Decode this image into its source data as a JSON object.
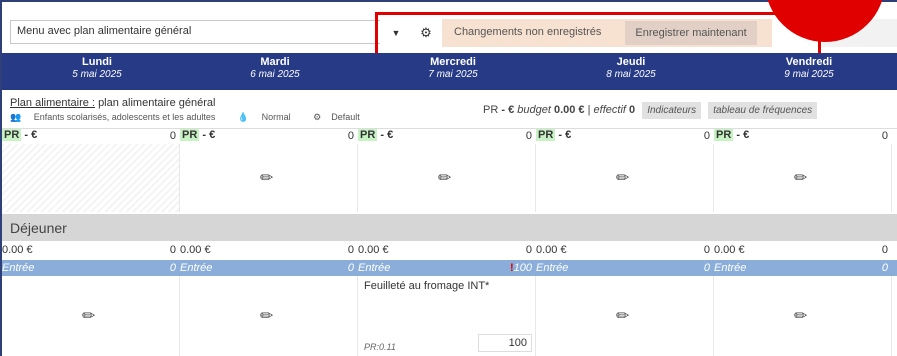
{
  "toolbar": {
    "menu_name": "Menu avec plan alimentaire général",
    "unsaved_text": "Changements non enregistrés",
    "save_label": "Enregistrer maintenant"
  },
  "days": [
    {
      "name": "Lundi",
      "date": "5 mai 2025"
    },
    {
      "name": "Mardi",
      "date": "6 mai 2025"
    },
    {
      "name": "Mercredi",
      "date": "7 mai 2025"
    },
    {
      "name": "Jeudi",
      "date": "8 mai 2025"
    },
    {
      "name": "Vendredi",
      "date": "9 mai 2025"
    }
  ],
  "plan": {
    "label": "Plan alimentaire :",
    "value": "plan alimentaire général",
    "audience": "Enfants scolarisés, adolescents et les adultes",
    "mode": "Normal",
    "profile": "Default",
    "pr_prefix": "PR",
    "pr_value": "- €",
    "budget_label": "budget",
    "budget_value": "0.00 €",
    "effectif_label": "effectif",
    "effectif_value": "0",
    "indicateurs_label": "Indicateurs",
    "frequences_label": "tableau de fréquences"
  },
  "pr_cells": [
    {
      "tag": "PR",
      "value": "- €",
      "count": "0"
    },
    {
      "tag": "PR",
      "value": "- €",
      "count": "0"
    },
    {
      "tag": "PR",
      "value": "- €",
      "count": "0"
    },
    {
      "tag": "PR",
      "value": "- €",
      "count": "0"
    },
    {
      "tag": "PR",
      "value": "- €",
      "count": "0"
    }
  ],
  "meal": {
    "name": "Déjeuner",
    "costs": [
      {
        "amount": "0.00 €",
        "count": "0"
      },
      {
        "amount": "0.00 €",
        "count": "0"
      },
      {
        "amount": "0.00 €",
        "count": "0"
      },
      {
        "amount": "0.00 €",
        "count": "0"
      },
      {
        "amount": "0.00 €",
        "count": "0"
      }
    ],
    "entrees": [
      {
        "label": "Entrée",
        "count": "0"
      },
      {
        "label": "Entrée",
        "count": "0"
      },
      {
        "label": "Entrée",
        "count": "100",
        "alert": "!"
      },
      {
        "label": "Entrée",
        "count": "0"
      },
      {
        "label": "Entrée",
        "count": "0"
      }
    ],
    "dish": {
      "name": "Feuilleté au fromage INT*",
      "pr": "PR:0.11",
      "qty": "100"
    }
  },
  "colors": {
    "header_bg": "#263a86",
    "highlight": "#e00000",
    "entree_bg": "#8aaed9",
    "pr_tag_bg": "#c7f2c4"
  }
}
